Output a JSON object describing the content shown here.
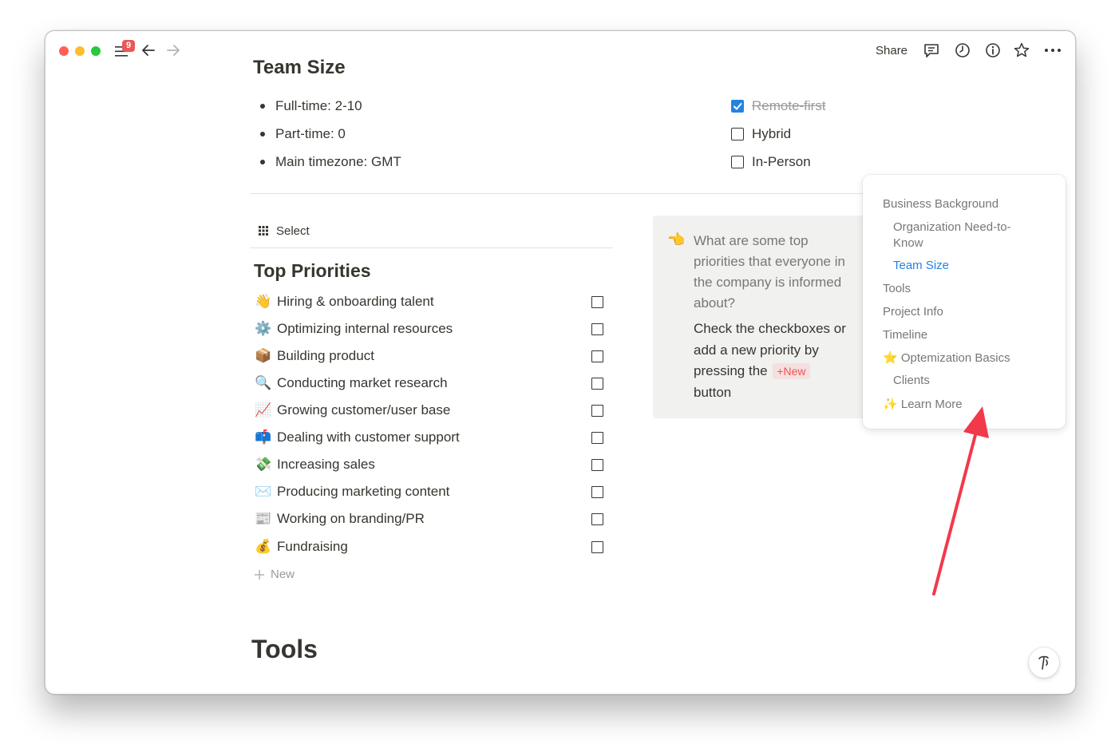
{
  "toolbar": {
    "badge_count": "9",
    "share_label": "Share",
    "icons": [
      "menu-icon",
      "arrow-left-icon",
      "arrow-right-icon",
      "comment-icon",
      "clock-icon",
      "info-icon",
      "star-icon",
      "more-icon"
    ]
  },
  "team_size": {
    "heading": "Team Size",
    "bullets": [
      "Full-time: 2-10",
      "Part-time: 0",
      "Main timezone: GMT"
    ],
    "work_modes": [
      {
        "label": "Remote-first",
        "checked": true
      },
      {
        "label": "Hybrid",
        "checked": false
      },
      {
        "label": "In-Person",
        "checked": false
      }
    ]
  },
  "priorities": {
    "view_label": "Select",
    "title": "Top Priorities",
    "items": [
      {
        "emoji": "👋",
        "label": "Hiring & onboarding talent"
      },
      {
        "emoji": "⚙️",
        "label": "Optimizing internal resources"
      },
      {
        "emoji": "📦",
        "label": "Building product"
      },
      {
        "emoji": "🔍",
        "label": "Conducting market research"
      },
      {
        "emoji": "📈",
        "label": "Growing customer/user base"
      },
      {
        "emoji": "📫",
        "label": "Dealing with customer support"
      },
      {
        "emoji": "💸",
        "label": "Increasing sales"
      },
      {
        "emoji": "✉️",
        "label": "Producing marketing content"
      },
      {
        "emoji": "📰",
        "label": "Working on branding/PR"
      },
      {
        "emoji": "💰",
        "label": "Fundraising"
      }
    ],
    "new_label": "New"
  },
  "callout": {
    "emoji": "👈",
    "question_lines": [
      "What are some top",
      "priorities that everyone in",
      "the company is informed",
      "about?"
    ],
    "instruction_lines": [
      "Check the checkboxes or",
      "add a new priority by"
    ],
    "pressing_text": "pressing the",
    "new_tag": "+New",
    "button_text": "button"
  },
  "toc": {
    "items": [
      {
        "label": "Business Background",
        "level": 0,
        "active": false,
        "emoji": ""
      },
      {
        "label": "Organization Need-to-",
        "label2": "Know",
        "level": 1,
        "active": false,
        "emoji": ""
      },
      {
        "label": "Team Size",
        "level": 1,
        "active": true,
        "emoji": ""
      },
      {
        "label": "Tools",
        "level": 0,
        "active": false,
        "emoji": ""
      },
      {
        "label": "Project Info",
        "level": 0,
        "active": false,
        "emoji": ""
      },
      {
        "label": "Timeline",
        "level": 0,
        "active": false,
        "emoji": ""
      },
      {
        "label": "Optemization Basics",
        "level": 0,
        "active": false,
        "emoji": "⭐"
      },
      {
        "label": "Clients",
        "level": 1,
        "active": false,
        "emoji": ""
      },
      {
        "label": "Learn More",
        "level": 0,
        "active": false,
        "emoji": "✨"
      }
    ],
    "active_color": "#2383e2"
  },
  "tools": {
    "heading": "Tools"
  },
  "help_button": {
    "icon": "help-icon"
  },
  "annotation": {
    "color": "#f2394a"
  }
}
